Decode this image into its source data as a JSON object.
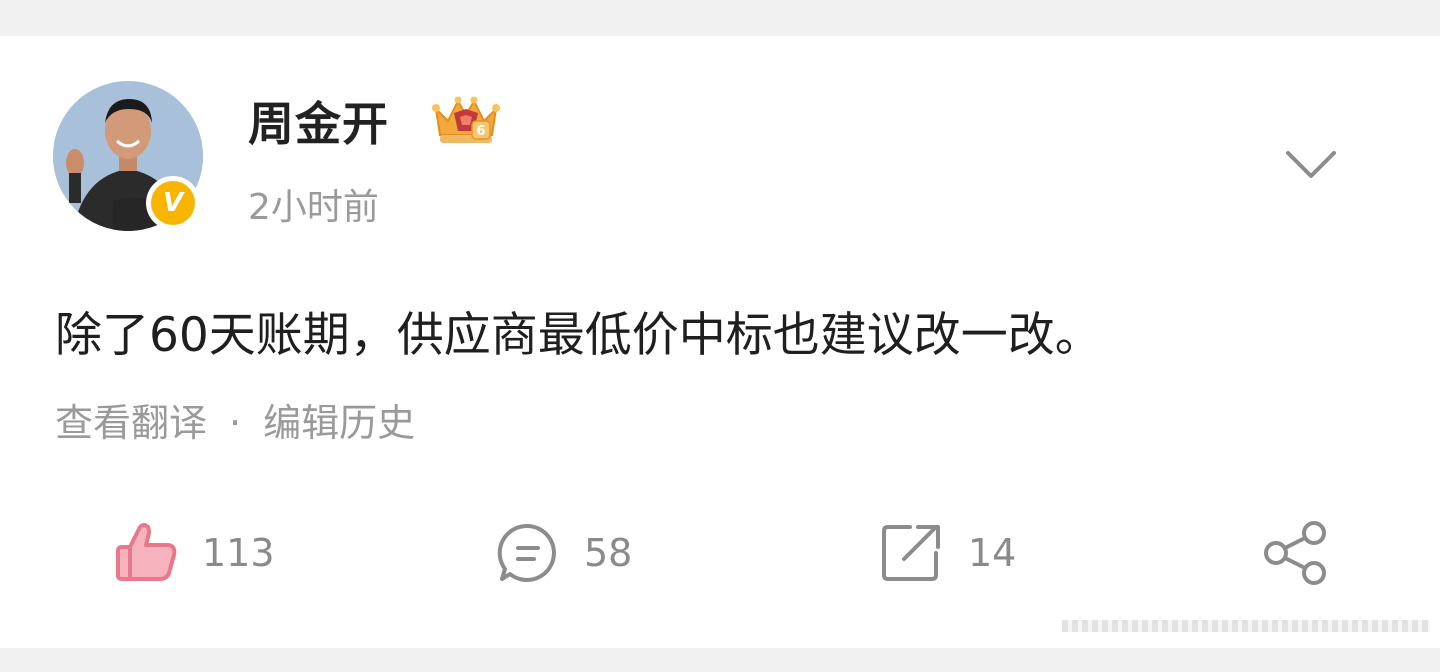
{
  "post": {
    "author_name": "周金开",
    "verified_badge_letter": "V",
    "timestamp": "2小时前",
    "content": "除了60天账期，供应商最低价中标也建议改一改。",
    "meta": {
      "translate_label": "查看翻译",
      "separator": "·",
      "edit_history_label": "编辑历史"
    },
    "actions": {
      "like_count": "113",
      "comment_count": "58",
      "repost_count": "14"
    }
  },
  "colors": {
    "like_icon": "#e8798a",
    "muted_text": "#9a9a9a",
    "badge": "#f7b500",
    "crown": "#f2a93b"
  },
  "icons": {
    "avatar": "avatar-photo",
    "verified": "verified-v-icon",
    "membership": "crown-level-icon",
    "more": "chevron-down-icon",
    "like": "thumbs-up-icon",
    "comment": "comment-bubble-icon",
    "repost": "repost-icon",
    "share": "share-icon"
  }
}
